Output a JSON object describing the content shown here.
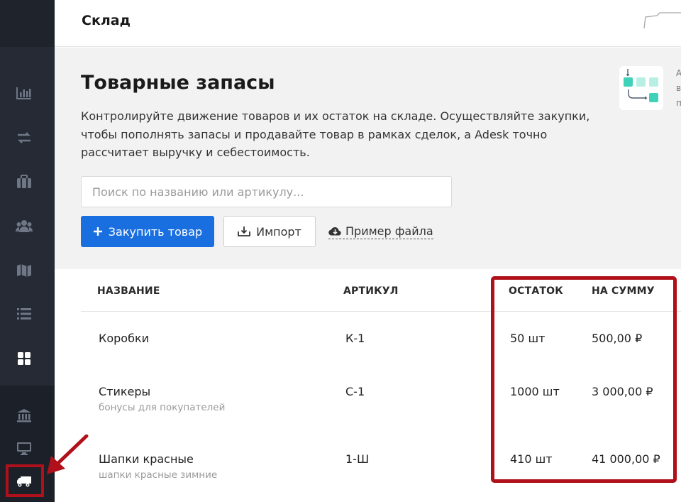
{
  "header": {
    "title": "Склад"
  },
  "sidebar": {
    "items": [
      {
        "name": "sidebar-item-analytics",
        "icon": "bar-chart-icon"
      },
      {
        "name": "sidebar-item-transfers",
        "icon": "arrows-exchange-icon"
      },
      {
        "name": "sidebar-item-projects",
        "icon": "briefcase-icon"
      },
      {
        "name": "sidebar-item-contacts",
        "icon": "users-icon"
      },
      {
        "name": "sidebar-item-map",
        "icon": "map-icon"
      },
      {
        "name": "sidebar-item-list",
        "icon": "list-icon"
      },
      {
        "name": "sidebar-item-dashboard",
        "icon": "grid-icon"
      },
      {
        "name": "sidebar-item-bank",
        "icon": "bank-icon"
      },
      {
        "name": "sidebar-item-monitor",
        "icon": "monitor-icon"
      },
      {
        "name": "sidebar-item-warehouse",
        "icon": "truck-icon",
        "active": true
      }
    ]
  },
  "intro": {
    "title": "Товарные запасы",
    "description": "Контролируйте движение товаров и их остаток на складе. Осуществляйте закупки, чтобы пополнять запасы и продавайте товар в рамках сделок, а Adesk точно рассчитает выручку и себестоимость.",
    "search_placeholder": "Поиск по названию или артикулу...",
    "buy_button": "Закупить товар",
    "import_button": "Импорт",
    "sample_link": "Пример файла",
    "peek_text": [
      "А",
      "в",
      "п"
    ]
  },
  "table": {
    "columns": [
      "НАЗВАНИЕ",
      "АРТИКУЛ",
      "ОСТАТОК",
      "НА СУММУ"
    ],
    "rows": [
      {
        "name": "Коробки",
        "subtitle": "",
        "sku": "К-1",
        "stock": "50 шт",
        "amount": "500,00 ₽"
      },
      {
        "name": "Стикеры",
        "subtitle": "бонусы для покупателей",
        "sku": "С-1",
        "stock": "1000 шт",
        "amount": "3 000,00 ₽"
      },
      {
        "name": "Шапки красные",
        "subtitle": "шапки красные зимние",
        "sku": "1-Ш",
        "stock": "410 шт",
        "amount": "41 000,00 ₽"
      }
    ]
  },
  "colors": {
    "sidebar": "#252a35",
    "primary": "#1a6fe0",
    "annotation": "#b0101a",
    "accent_teal": "#3fd2b8"
  }
}
